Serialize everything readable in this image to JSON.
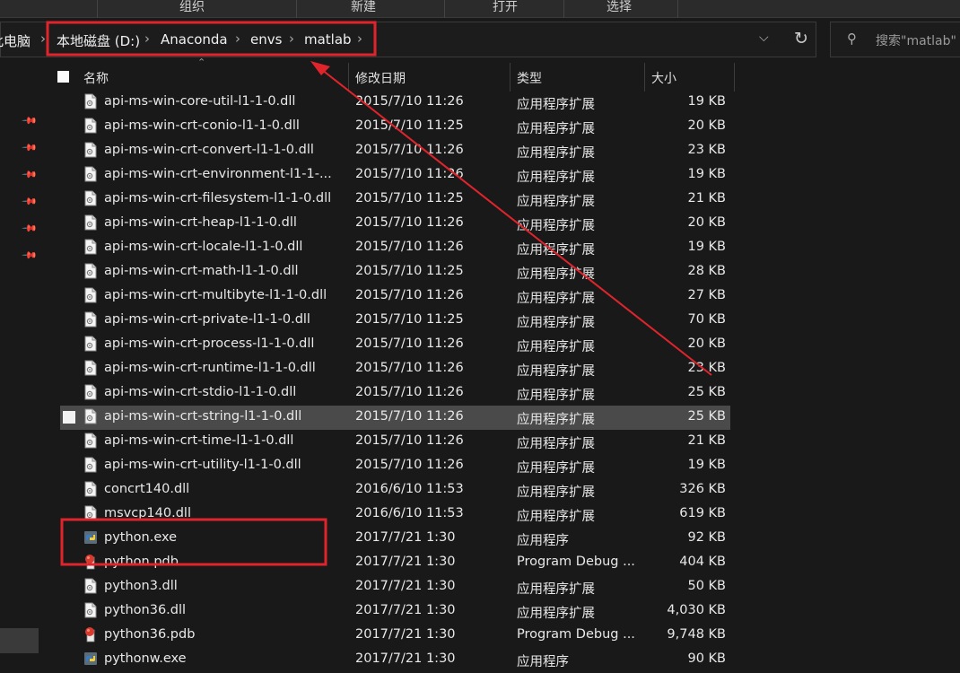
{
  "ribbon": {
    "groups": [
      "组织",
      "新建",
      "打开",
      "选择"
    ]
  },
  "address": {
    "crumbs": [
      "此电脑",
      "本地磁盘 (D:)",
      "Anaconda",
      "envs",
      "matlab"
    ]
  },
  "search": {
    "placeholder": "搜索\"matlab\""
  },
  "columns": {
    "name": "名称",
    "date": "修改日期",
    "type": "类型",
    "size": "大小"
  },
  "files": [
    {
      "name": "api-ms-win-core-util-l1-1-0.dll",
      "date": "2015/7/10 11:26",
      "type": "应用程序扩展",
      "size": "19 KB",
      "icon": "dll-icon"
    },
    {
      "name": "api-ms-win-crt-conio-l1-1-0.dll",
      "date": "2015/7/10 11:25",
      "type": "应用程序扩展",
      "size": "20 KB",
      "icon": "dll-icon"
    },
    {
      "name": "api-ms-win-crt-convert-l1-1-0.dll",
      "date": "2015/7/10 11:26",
      "type": "应用程序扩展",
      "size": "23 KB",
      "icon": "dll-icon"
    },
    {
      "name": "api-ms-win-crt-environment-l1-1-...",
      "date": "2015/7/10 11:26",
      "type": "应用程序扩展",
      "size": "19 KB",
      "icon": "dll-icon"
    },
    {
      "name": "api-ms-win-crt-filesystem-l1-1-0.dll",
      "date": "2015/7/10 11:25",
      "type": "应用程序扩展",
      "size": "21 KB",
      "icon": "dll-icon"
    },
    {
      "name": "api-ms-win-crt-heap-l1-1-0.dll",
      "date": "2015/7/10 11:26",
      "type": "应用程序扩展",
      "size": "20 KB",
      "icon": "dll-icon"
    },
    {
      "name": "api-ms-win-crt-locale-l1-1-0.dll",
      "date": "2015/7/10 11:26",
      "type": "应用程序扩展",
      "size": "19 KB",
      "icon": "dll-icon"
    },
    {
      "name": "api-ms-win-crt-math-l1-1-0.dll",
      "date": "2015/7/10 11:25",
      "type": "应用程序扩展",
      "size": "28 KB",
      "icon": "dll-icon"
    },
    {
      "name": "api-ms-win-crt-multibyte-l1-1-0.dll",
      "date": "2015/7/10 11:26",
      "type": "应用程序扩展",
      "size": "27 KB",
      "icon": "dll-icon"
    },
    {
      "name": "api-ms-win-crt-private-l1-1-0.dll",
      "date": "2015/7/10 11:25",
      "type": "应用程序扩展",
      "size": "70 KB",
      "icon": "dll-icon"
    },
    {
      "name": "api-ms-win-crt-process-l1-1-0.dll",
      "date": "2015/7/10 11:26",
      "type": "应用程序扩展",
      "size": "20 KB",
      "icon": "dll-icon"
    },
    {
      "name": "api-ms-win-crt-runtime-l1-1-0.dll",
      "date": "2015/7/10 11:26",
      "type": "应用程序扩展",
      "size": "23 KB",
      "icon": "dll-icon"
    },
    {
      "name": "api-ms-win-crt-stdio-l1-1-0.dll",
      "date": "2015/7/10 11:26",
      "type": "应用程序扩展",
      "size": "25 KB",
      "icon": "dll-icon"
    },
    {
      "name": "api-ms-win-crt-string-l1-1-0.dll",
      "date": "2015/7/10 11:26",
      "type": "应用程序扩展",
      "size": "25 KB",
      "icon": "dll-icon"
    },
    {
      "name": "api-ms-win-crt-time-l1-1-0.dll",
      "date": "2015/7/10 11:26",
      "type": "应用程序扩展",
      "size": "21 KB",
      "icon": "dll-icon"
    },
    {
      "name": "api-ms-win-crt-utility-l1-1-0.dll",
      "date": "2015/7/10 11:26",
      "type": "应用程序扩展",
      "size": "19 KB",
      "icon": "dll-icon"
    },
    {
      "name": "concrt140.dll",
      "date": "2016/6/10 11:53",
      "type": "应用程序扩展",
      "size": "326 KB",
      "icon": "dll-icon"
    },
    {
      "name": "msvcp140.dll",
      "date": "2016/6/10 11:53",
      "type": "应用程序扩展",
      "size": "619 KB",
      "icon": "dll-icon"
    },
    {
      "name": "python.exe",
      "date": "2017/7/21 1:30",
      "type": "应用程序",
      "size": "92 KB",
      "icon": "python-exe-icon"
    },
    {
      "name": "python.pdb",
      "date": "2017/7/21 1:30",
      "type": "Program Debug ...",
      "size": "404 KB",
      "icon": "pdb-icon"
    },
    {
      "name": "python3.dll",
      "date": "2017/7/21 1:30",
      "type": "应用程序扩展",
      "size": "50 KB",
      "icon": "dll-icon"
    },
    {
      "name": "python36.dll",
      "date": "2017/7/21 1:30",
      "type": "应用程序扩展",
      "size": "4,030 KB",
      "icon": "dll-icon"
    },
    {
      "name": "python36.pdb",
      "date": "2017/7/21 1:30",
      "type": "Program Debug ...",
      "size": "9,748 KB",
      "icon": "pdb-icon"
    },
    {
      "name": "pythonw.exe",
      "date": "2017/7/21 1:30",
      "type": "应用程序",
      "size": "90 KB",
      "icon": "python-exe-icon"
    }
  ],
  "hovered_file": "api-ms-win-crt-string-l1-1-0.dll",
  "colors": {
    "annotation": "#e0242c",
    "background": "#191919",
    "hover_row": "#4a4a4a"
  }
}
